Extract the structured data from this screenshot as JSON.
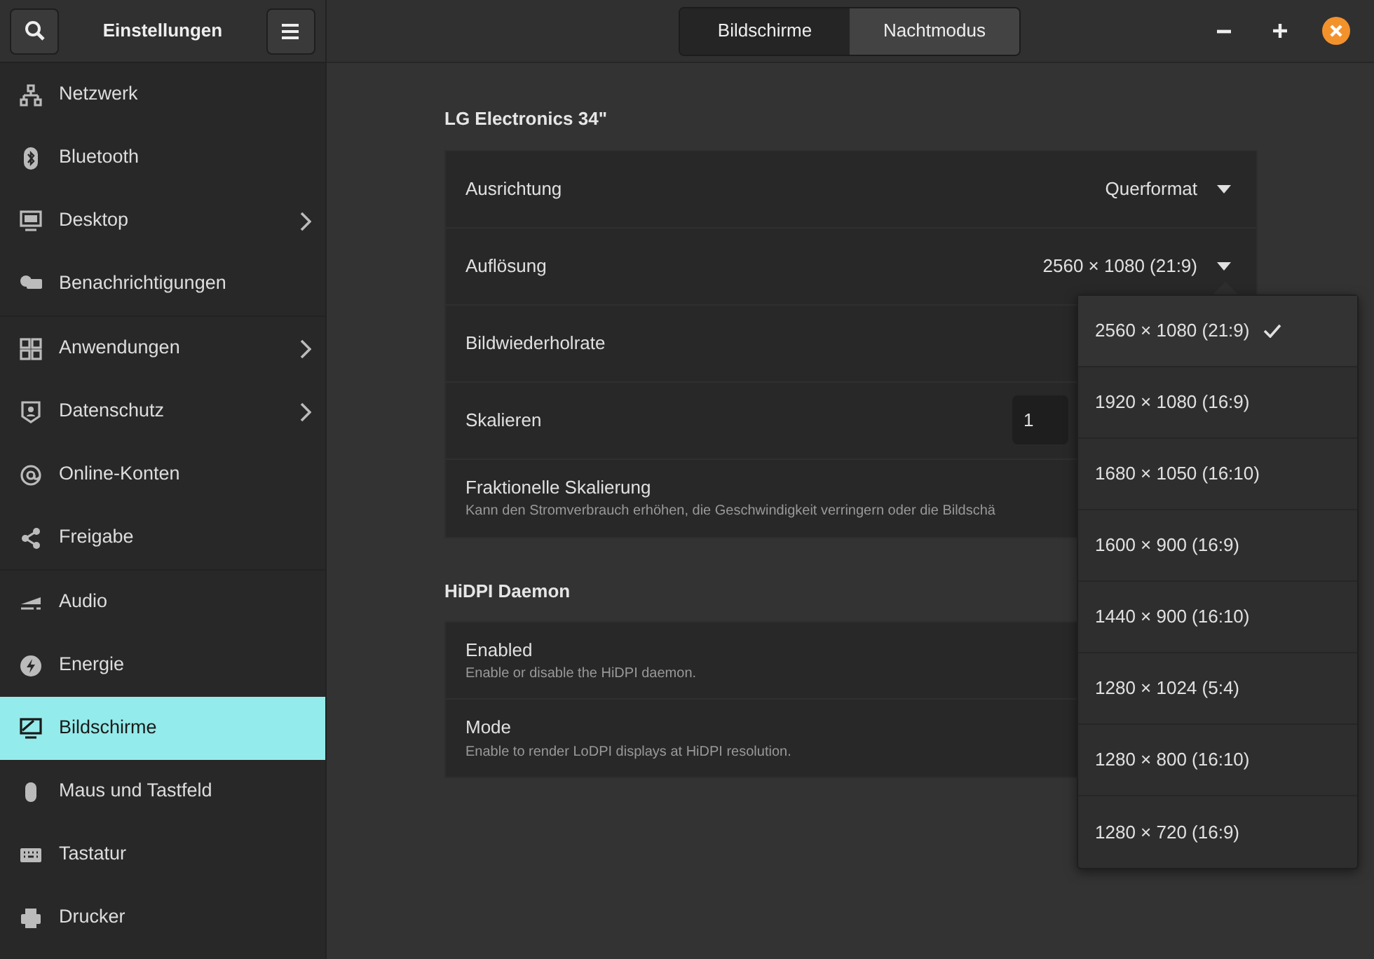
{
  "window": {
    "title": "Einstellungen"
  },
  "tabs": [
    {
      "label": "Bildschirme",
      "selected": true
    },
    {
      "label": "Nachtmodus",
      "selected": false
    }
  ],
  "sidebar": {
    "groups": [
      [
        {
          "label": "Netzwerk",
          "has_children": false,
          "selected": false
        },
        {
          "label": "Bluetooth",
          "has_children": false,
          "selected": false
        },
        {
          "label": "Desktop",
          "has_children": true,
          "selected": false
        },
        {
          "label": "Benachrichtigungen",
          "has_children": false,
          "selected": false
        }
      ],
      [
        {
          "label": "Anwendungen",
          "has_children": true,
          "selected": false
        },
        {
          "label": "Datenschutz",
          "has_children": true,
          "selected": false
        },
        {
          "label": "Online-Konten",
          "has_children": false,
          "selected": false
        },
        {
          "label": "Freigabe",
          "has_children": false,
          "selected": false
        }
      ],
      [
        {
          "label": "Audio",
          "has_children": false,
          "selected": false
        },
        {
          "label": "Energie",
          "has_children": false,
          "selected": false
        },
        {
          "label": "Bildschirme",
          "has_children": false,
          "selected": true
        },
        {
          "label": "Maus und Tastfeld",
          "has_children": false,
          "selected": false
        },
        {
          "label": "Tastatur",
          "has_children": false,
          "selected": false
        },
        {
          "label": "Drucker",
          "has_children": false,
          "selected": false
        }
      ]
    ]
  },
  "sections": [
    {
      "title": "LG Electronics 34\"",
      "rows": [
        {
          "kind": "dropdown",
          "label": "Ausrichtung",
          "value": "Querformat"
        },
        {
          "kind": "dropdown",
          "label": "Auflösung",
          "value": "2560 × 1080 (21:9)"
        },
        {
          "kind": "plain",
          "label": "Bildwiederholrate"
        },
        {
          "kind": "field",
          "label": "Skalieren",
          "value": "1"
        },
        {
          "kind": "plain",
          "label": "Fraktionelle Skalierung",
          "description": "Kann den Stromverbrauch erhöhen, die Geschwindigkeit verringern oder die Bildschä"
        }
      ]
    },
    {
      "title": "HiDPI Daemon",
      "rows": [
        {
          "kind": "plain",
          "label": "Enabled",
          "description": "Enable or disable the HiDPI daemon."
        },
        {
          "kind": "plain",
          "label": "Mode",
          "description": "Enable to render LoDPI displays at HiDPI resolution."
        }
      ]
    }
  ],
  "popover": {
    "options": [
      {
        "label": "2560 × 1080 (21:9)",
        "selected": true
      },
      {
        "label": "1920 × 1080 (16:9)",
        "selected": false
      },
      {
        "label": "1680 × 1050 (16:10)",
        "selected": false
      },
      {
        "label": "1600 × 900 (16:9)",
        "selected": false
      },
      {
        "label": "1440 × 900 (16:10)",
        "selected": false
      },
      {
        "label": "1280 × 1024 (5:4)",
        "selected": false
      },
      {
        "label": "1280 × 800 (16:10)",
        "selected": false
      },
      {
        "label": "1280 × 720 (16:9)",
        "selected": false
      }
    ]
  }
}
